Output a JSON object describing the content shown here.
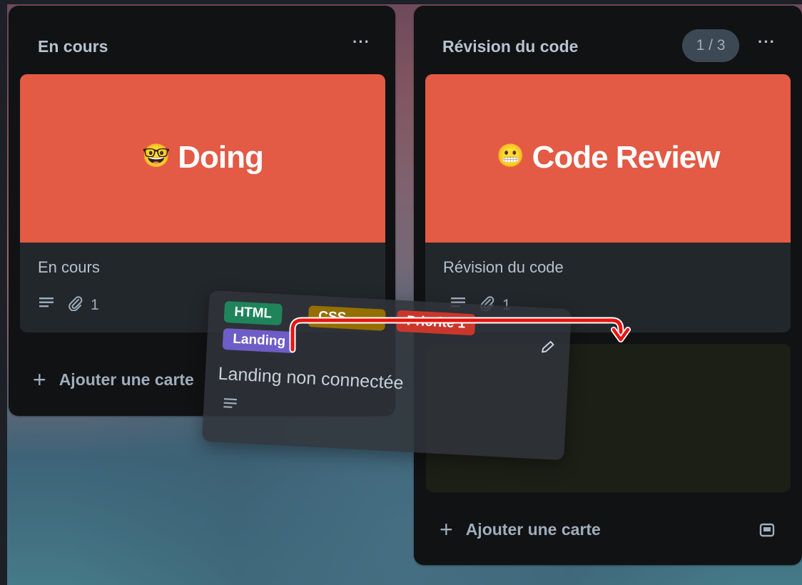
{
  "lists": [
    {
      "title": "En cours",
      "menu_label": "···",
      "card": {
        "cover_emoji": "🤓",
        "cover_title": "Doing",
        "name": "En cours",
        "attachments": "1"
      },
      "add_card_label": "Ajouter une carte"
    },
    {
      "title": "Révision du code",
      "counter": "1 / 3",
      "menu_label": "···",
      "card": {
        "cover_emoji": "😬",
        "cover_title": "Code Review",
        "name": "Révision du code",
        "attachments": "1"
      },
      "add_card_label": "Ajouter une carte"
    }
  ],
  "dragged_card": {
    "labels": [
      {
        "text": "HTML",
        "color": "#1f845a"
      },
      {
        "text": "CSS",
        "color": "#946f00"
      },
      {
        "text": "Priorité 1",
        "color": "#c9372c"
      },
      {
        "text": "Landing",
        "color": "#6e5dc6"
      }
    ],
    "title": "Landing non connectée"
  },
  "colors": {
    "cover": "#e35a45",
    "arrow": "#e8140f"
  }
}
